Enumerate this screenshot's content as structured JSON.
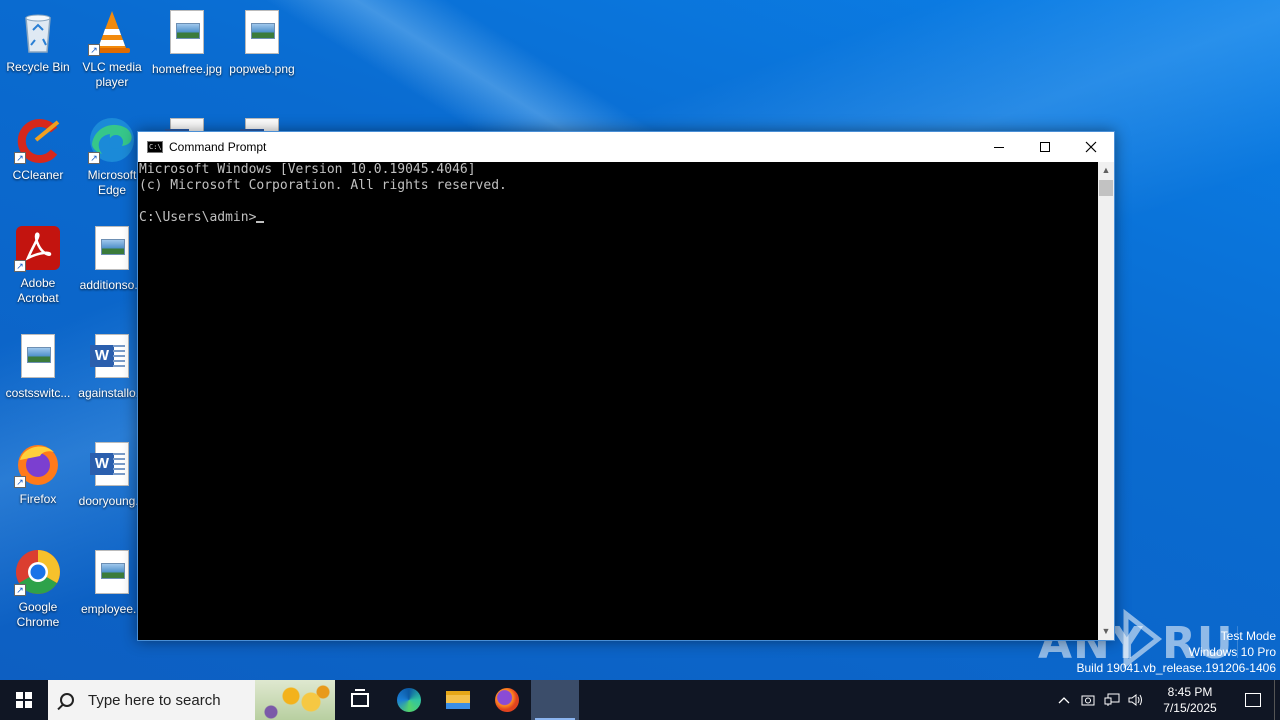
{
  "desktop": {
    "icons": [
      {
        "label": "Recycle Bin"
      },
      {
        "label": "VLC media player"
      },
      {
        "label": "homefree.jpg"
      },
      {
        "label": "popweb.png"
      },
      {
        "label": "CCleaner"
      },
      {
        "label": "Microsoft Edge"
      },
      {
        "label": "Adobe Acrobat"
      },
      {
        "label": "additionso..."
      },
      {
        "label": "costsswitc..."
      },
      {
        "label": "againstallo..."
      },
      {
        "label": "Firefox"
      },
      {
        "label": "dooryoung..."
      },
      {
        "label": "Google Chrome"
      },
      {
        "label": "employee..."
      }
    ]
  },
  "cmd_window": {
    "title": "Command Prompt",
    "lines": [
      "Microsoft Windows [Version 10.0.19045.4046]",
      "(c) Microsoft Corporation. All rights reserved.",
      "",
      "C:\\Users\\admin>"
    ]
  },
  "watermark": {
    "logo": "ANY RUN",
    "line1": "Test Mode",
    "line2": "Windows 10 Pro",
    "line3": "Build 19041.vb_release.191206-1406"
  },
  "taskbar": {
    "search_placeholder": "Type here to search",
    "clock_time": "8:45 PM",
    "clock_date": "7/15/2025"
  },
  "colors": {
    "taskbar_bg": "#101624",
    "console_bg": "#000000",
    "console_text": "#c0c0c0",
    "desktop_blue": "#0a6fd6"
  }
}
